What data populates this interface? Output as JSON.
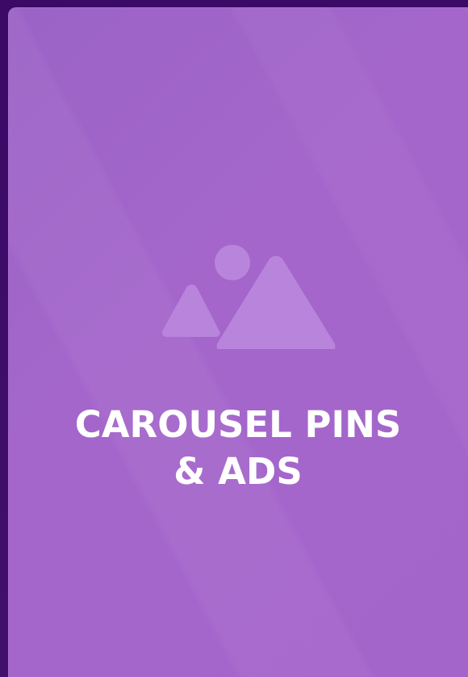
{
  "card": {
    "title_line_1": "CAROUSEL PINS",
    "title_line_2": "& ADS",
    "placeholder_icon": "image-placeholder-icon"
  },
  "colors": {
    "background": "#3b0a66",
    "card": "#a466cb",
    "icon": "#b985dc",
    "text": "#ffffff"
  }
}
